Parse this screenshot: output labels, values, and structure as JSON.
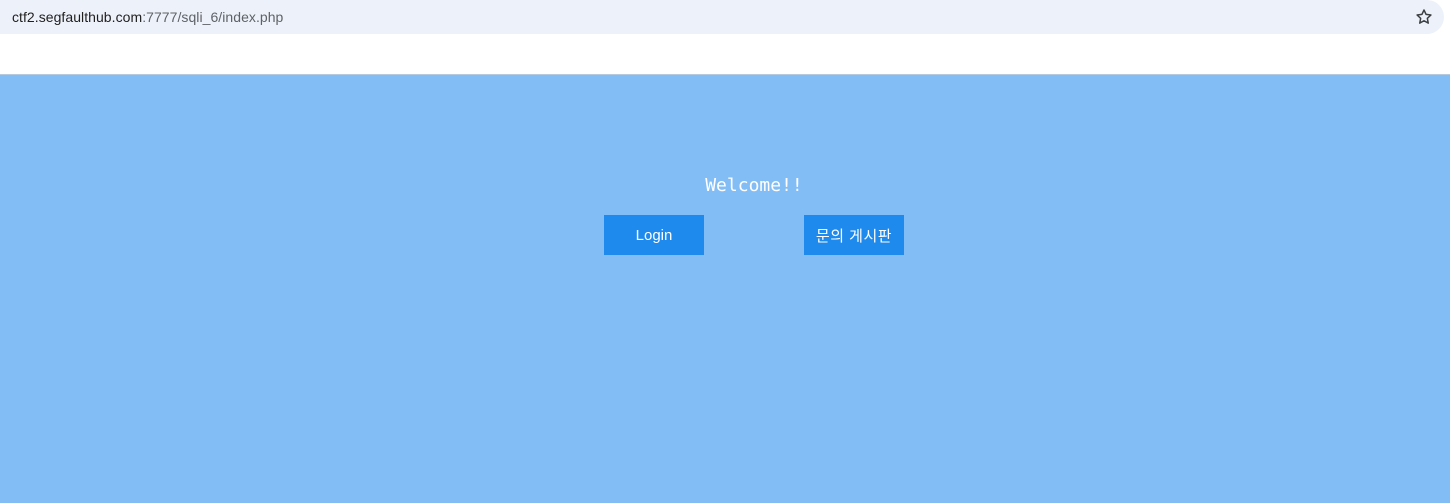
{
  "browser": {
    "url_host": "ctf2.segfaulthub.com",
    "url_path": ":7777/sqli_6/index.php",
    "bookmark_icon": "star-outline-icon"
  },
  "page": {
    "welcome": "Welcome!!",
    "login_label": "Login",
    "board_label": "문의 게시판"
  },
  "colors": {
    "page_background": "#83bdf6",
    "button_background": "#1e8aed",
    "button_text": "#ffffff",
    "url_bar_background": "#edf1f9"
  }
}
